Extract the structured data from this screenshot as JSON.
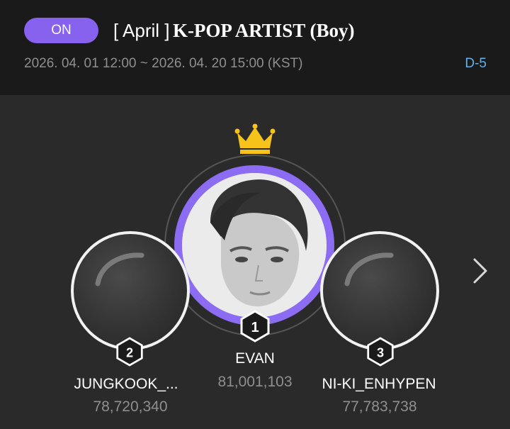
{
  "header": {
    "status_label": "ON",
    "title_month": "[ April ]",
    "title_main": "K-POP ARTIST (Boy)",
    "period": "2026. 04. 01 12:00 ~ 2026. 04. 20 15:00 (KST)",
    "dday": "D-5"
  },
  "colors": {
    "accent": "#8662ee",
    "dday": "#5fb2ee",
    "crown": "#f7c21a",
    "muted_text": "#8f8f8f"
  },
  "ranking": [
    {
      "rank": "1",
      "name": "EVAN",
      "votes": "81,001,103"
    },
    {
      "rank": "2",
      "name": "JUNGKOOK_...",
      "votes": "78,720,340"
    },
    {
      "rank": "3",
      "name": "NI-KI_ENHYPEN",
      "votes": "77,783,738"
    }
  ],
  "icons": {
    "crown": "crown-icon",
    "next": "chevron-right-icon"
  }
}
